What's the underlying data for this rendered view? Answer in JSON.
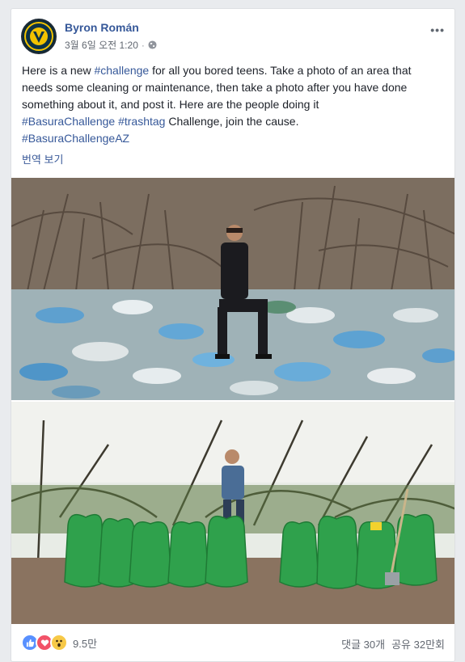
{
  "post": {
    "author": "Byron Román",
    "timestamp": "3월 6일 오전 1:20",
    "separator": "·",
    "privacy_icon": "globe-icon",
    "more_label": "•••",
    "text_lines": {
      "line1_a": "Here is a new ",
      "line1_tag": "#challenge",
      "line1_b": " for all you bored teens. Take a photo of an area that needs some cleaning or maintenance, then take a photo after you have done something about it, and post it. Here are the people doing it ",
      "tag_basura": "#BasuraChallenge",
      "space": " ",
      "tag_trashtag": "#trashtag",
      "line_c": " Challenge, join the cause.",
      "tag_az": "#BasuraChallengeAZ"
    },
    "translate_label": "번역 보기"
  },
  "reactions": {
    "icons": [
      "like-icon",
      "love-icon",
      "wow-icon"
    ],
    "count": "9.5만"
  },
  "stats": {
    "comments": "댓글 30개",
    "shares": "공유 32만회"
  },
  "colors": {
    "link": "#365899",
    "like": "#5890ff",
    "love": "#f25268",
    "wow": "#f7c947",
    "bag_green": "#2fa14c"
  }
}
